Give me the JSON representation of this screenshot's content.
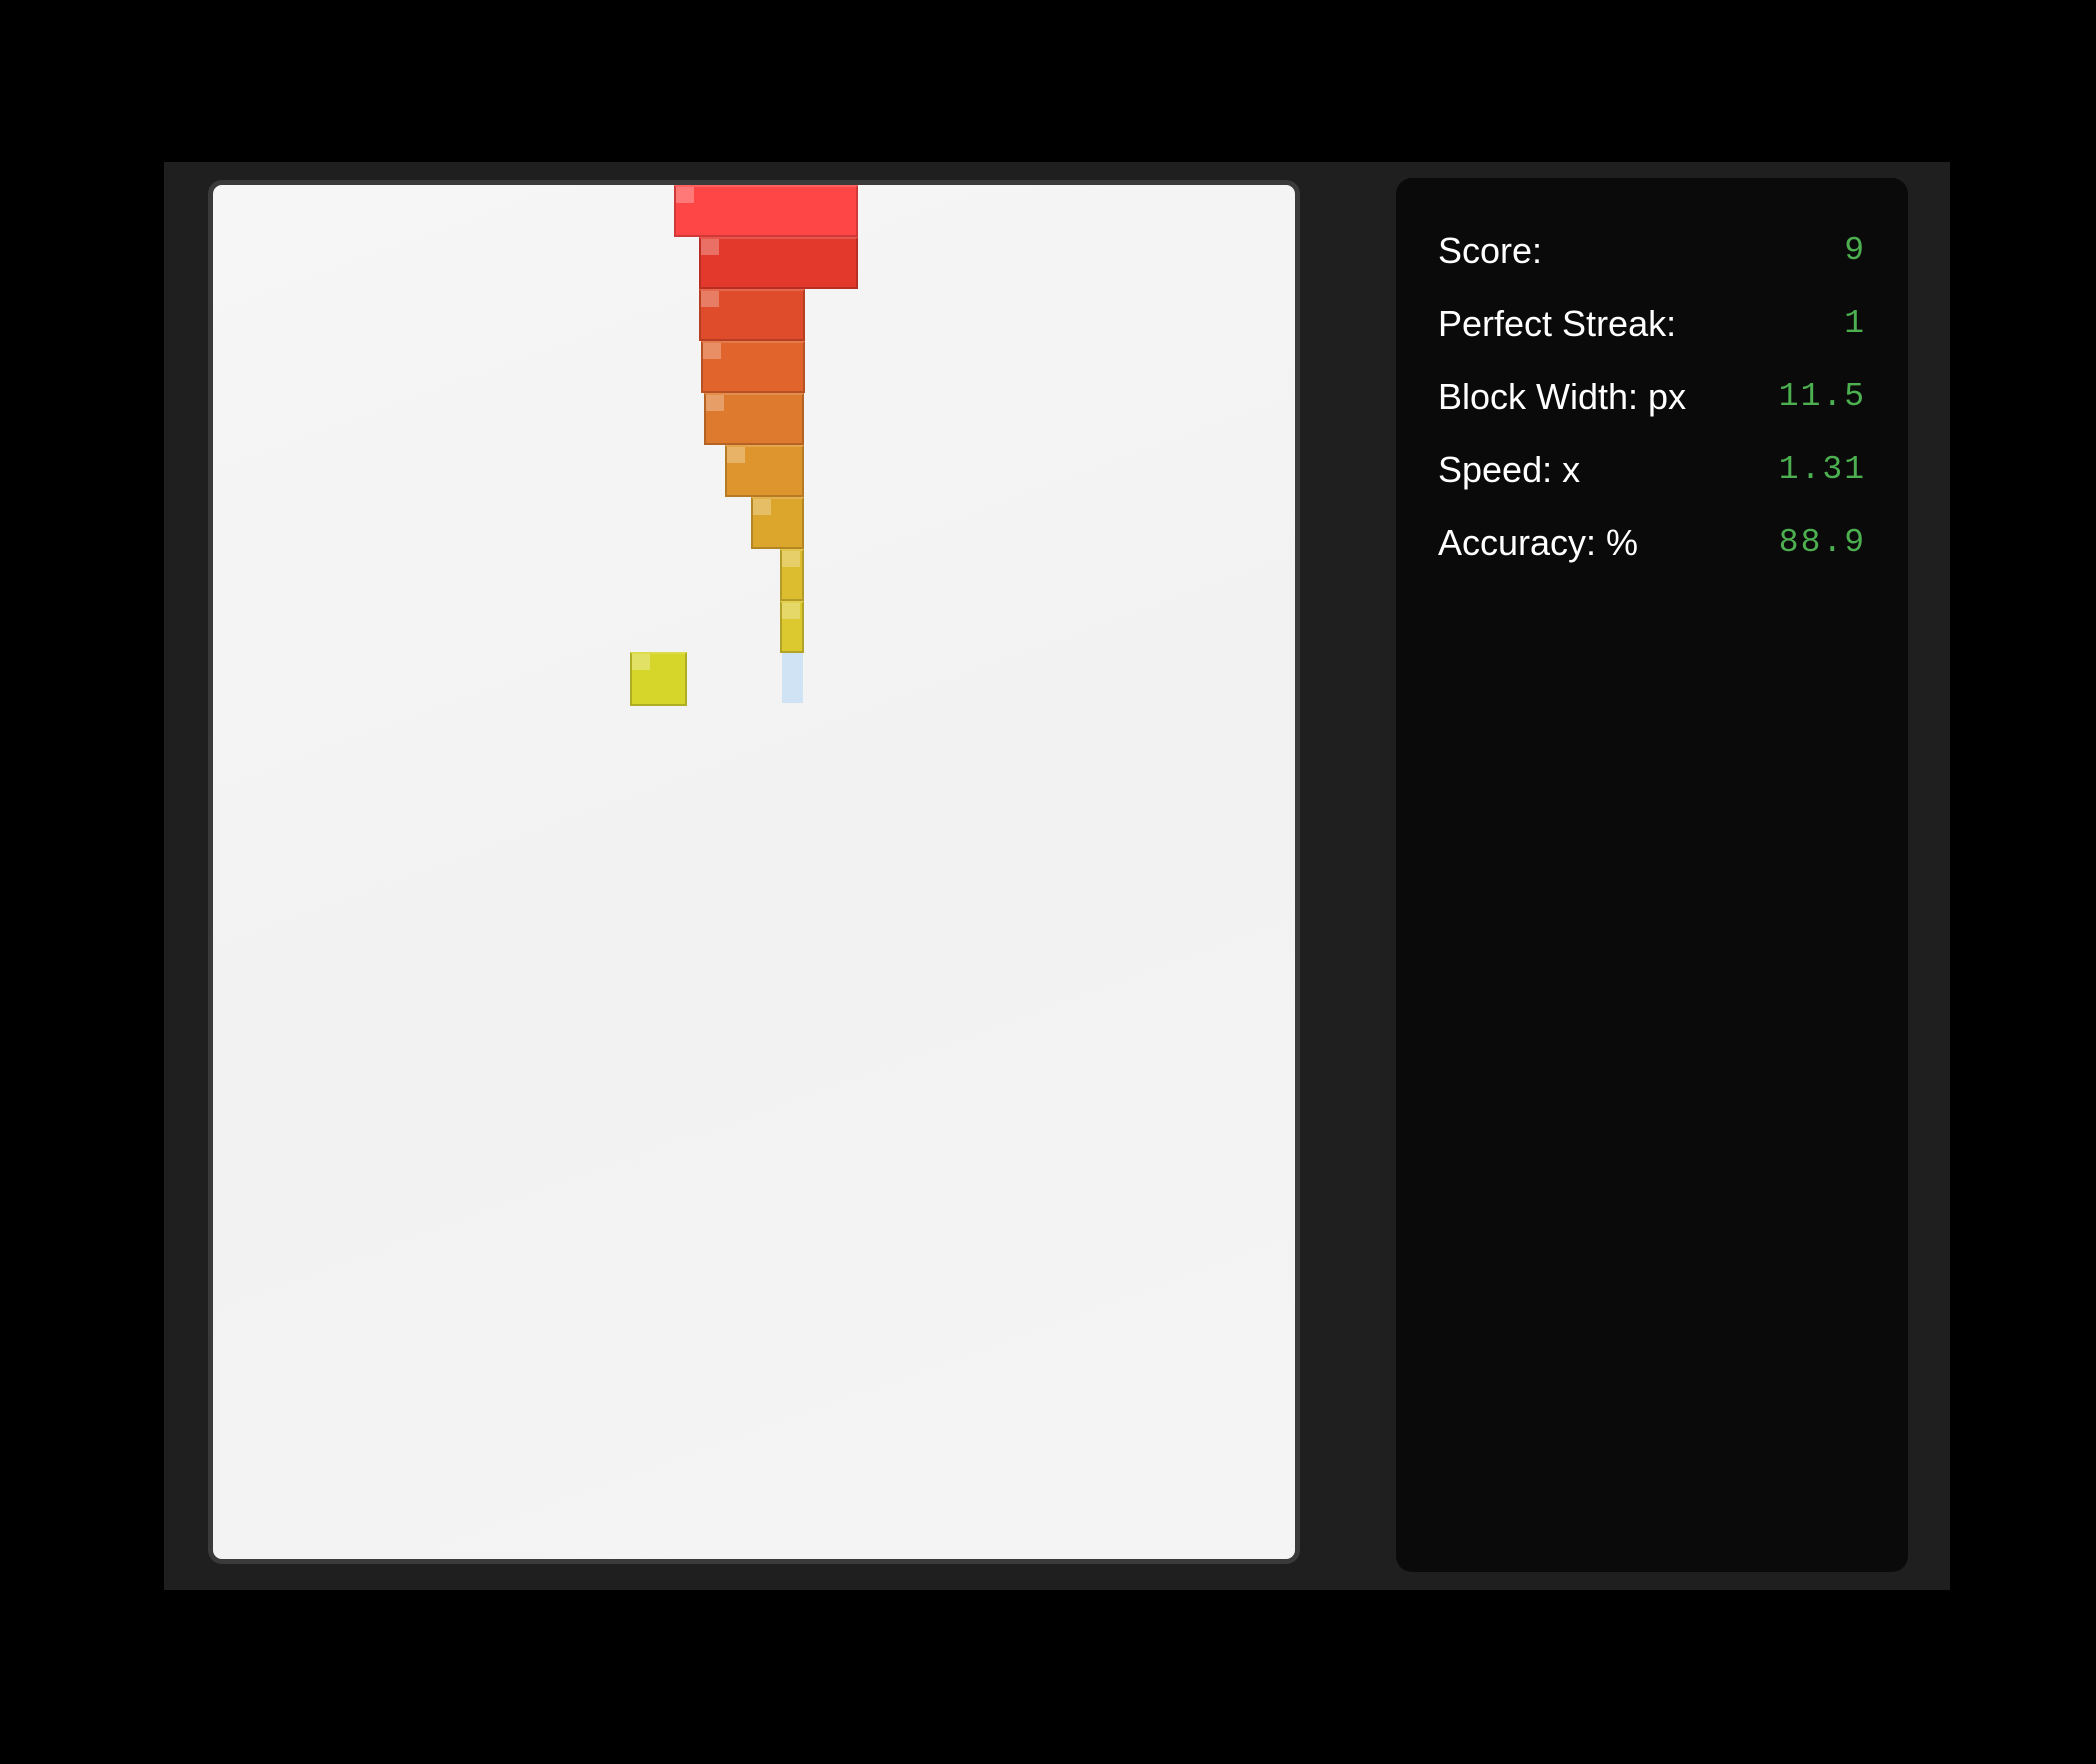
{
  "game": {
    "title": "",
    "colors": {
      "background": "#000000",
      "frame": "#1f1f1f",
      "board": "#f4f4f4",
      "panel": "#0a0a0a",
      "label": "#ffffff",
      "value": "#4caf50"
    },
    "stack": {
      "blocks": [
        {
          "color": "#ff4646"
        },
        {
          "color": "#e2392c"
        },
        {
          "color": "#df4c2c"
        },
        {
          "color": "#e0642b"
        },
        {
          "color": "#de7a2d"
        },
        {
          "color": "#df952d"
        },
        {
          "color": "#dca52c"
        },
        {
          "color": "#ddbd30"
        },
        {
          "color": "#dcc82f"
        }
      ],
      "moving_block": {
        "color": "#d6d62a"
      },
      "drop_guide": {
        "color": "#cfe3f5"
      }
    }
  },
  "stats": {
    "rows": [
      {
        "label": "Score:",
        "value": "9"
      },
      {
        "label": "Perfect Streak:",
        "value": "1"
      },
      {
        "label": "Block Width: px",
        "value": "11.5"
      },
      {
        "label": "Speed: x",
        "value": "1.31"
      },
      {
        "label": "Accuracy: %",
        "value": "88.9"
      }
    ]
  }
}
